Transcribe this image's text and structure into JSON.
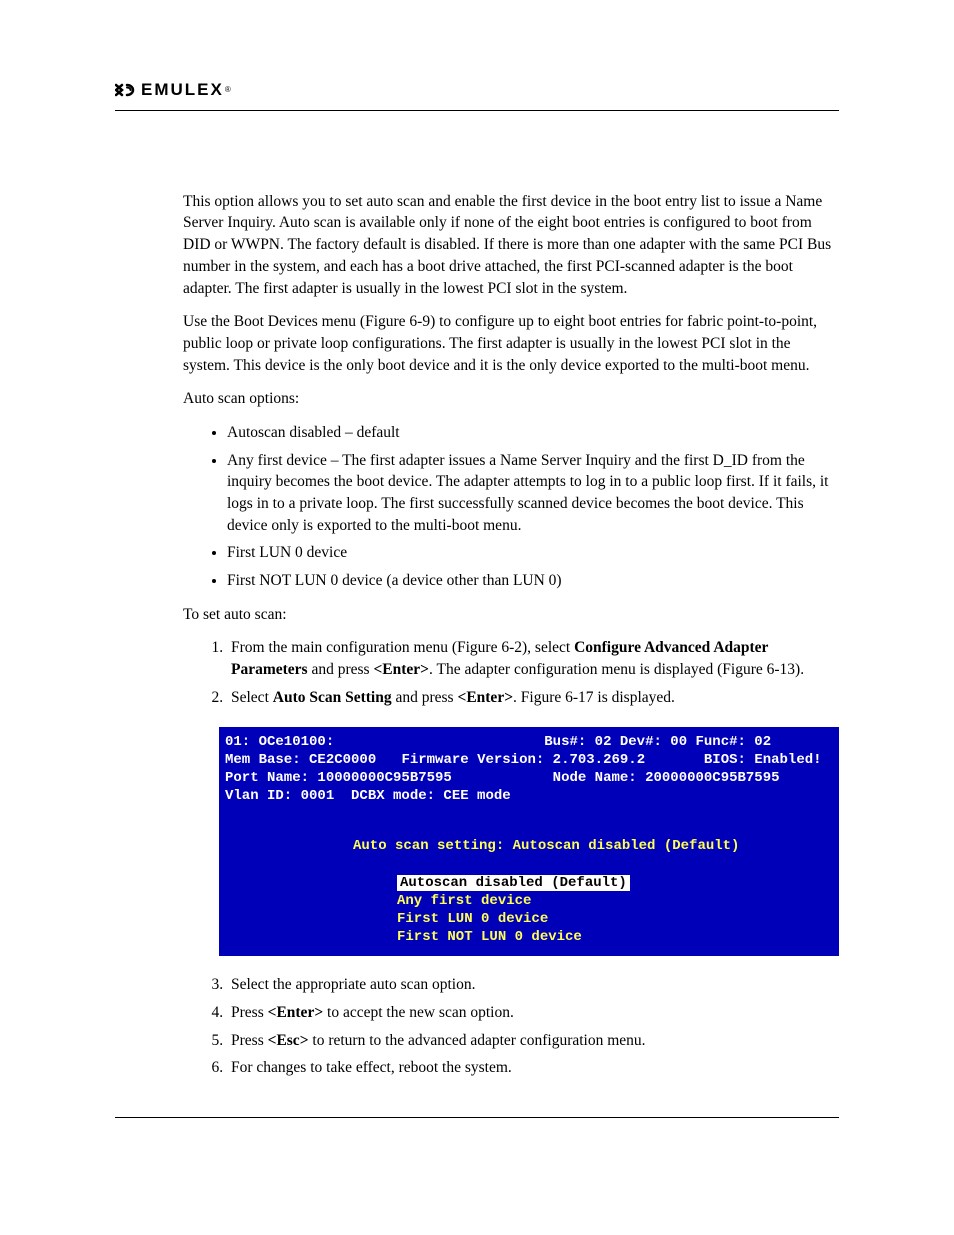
{
  "brand": {
    "name": "EMULEX",
    "tm": "®"
  },
  "paragraphs": {
    "p1": "This option allows you to set auto scan and enable the first device in the boot entry list to issue a Name Server Inquiry. Auto scan is available only if none of the eight boot entries is configured to boot from DID or WWPN. The factory default is disabled. If there is more than one adapter with the same PCI Bus number in the system, and each has a boot drive attached, the first PCI-scanned adapter is the boot adapter. The first adapter is usually in the lowest PCI slot in the system.",
    "p2": "Use the Boot Devices menu (Figure 6-9) to configure up to eight boot entries for fabric point-to-point, public loop or private loop configurations. The first adapter is usually in the lowest PCI slot in the system. This device is the only boot device and it is the only device exported to the multi-boot menu.",
    "p3": "Auto scan options:",
    "p4": "To set auto scan:"
  },
  "bullets": [
    "Autoscan disabled – default",
    "Any first device – The first adapter issues a Name Server Inquiry and the first D_ID from the inquiry becomes the boot device. The adapter attempts to log in to a public loop first. If it fails, it logs in to a private loop. The first successfully scanned device becomes the boot device. This device only is exported to the multi-boot menu.",
    "First LUN 0 device",
    "First NOT LUN 0 device (a device other than LUN 0)"
  ],
  "steps_top": {
    "s1a": "From the main configuration menu (Figure 6-2), select ",
    "s1b": "Configure Advanced Adapter Parameters",
    "s1c": " and press ",
    "s1d": "<Enter>",
    "s1e": ". The adapter configuration menu is displayed (Figure 6-13).",
    "s2a": "Select ",
    "s2b": "Auto Scan Setting",
    "s2c": " and press ",
    "s2d": "<Enter>",
    "s2e": ". Figure 6-17 is displayed."
  },
  "terminal": {
    "line1_left": "01: OCe10100:",
    "line1_right": "Bus#: 02 Dev#: 00 Func#: 02",
    "line2a": "Mem Base: CE2C0000",
    "line2b": "Firmware Version: 2.703.269.2",
    "line2c": "BIOS: Enabled!",
    "line3a": "Port Name: 10000000C95B7595",
    "line3b": "Node Name: 20000000C95B7595",
    "line4": "Vlan ID: 0001  DCBX mode: CEE mode",
    "setting": "Auto scan setting: Autoscan disabled (Default)",
    "opt_selected": "Autoscan disabled (Default)",
    "opt2": "Any first device",
    "opt3": "First LUN 0 device",
    "opt4": "First NOT LUN 0 device"
  },
  "steps_bottom": {
    "s3": "Select the appropriate auto scan option.",
    "s4a": "Press ",
    "s4b": "<Enter>",
    "s4c": " to accept the new scan option.",
    "s5a": "Press ",
    "s5b": "<Esc>",
    "s5c": " to return to the advanced adapter configuration menu.",
    "s6": "For changes to take effect, reboot the system."
  }
}
